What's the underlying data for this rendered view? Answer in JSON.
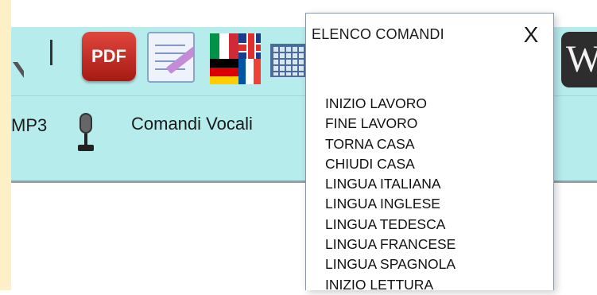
{
  "toolbar": {
    "pdf_label": "PDF",
    "mp3_label": "MP3",
    "voice_commands_label": "Comandi Vocali",
    "wiki_label": "W",
    "icons": [
      "tool-icon",
      "pdf-icon",
      "notepad-icon",
      "flags-icon",
      "calculator-icon",
      "microphone-icon",
      "wikipedia-icon"
    ],
    "colors": {
      "background": "#b7ecec",
      "left_strip": "#fdefc6",
      "pdf_red": "#c8281f"
    }
  },
  "dialog": {
    "title": "ELENCO COMANDI",
    "close_label": "X",
    "commands": [
      "INIZIO LAVORO",
      "FINE LAVORO",
      "TORNA CASA",
      "CHIUDI CASA",
      "LINGUA ITALIANA",
      "LINGUA INGLESE",
      "LINGUA TEDESCA",
      "LINGUA FRANCESE",
      "LINGUA SPAGNOLA",
      "INIZIO LETTURA"
    ]
  }
}
